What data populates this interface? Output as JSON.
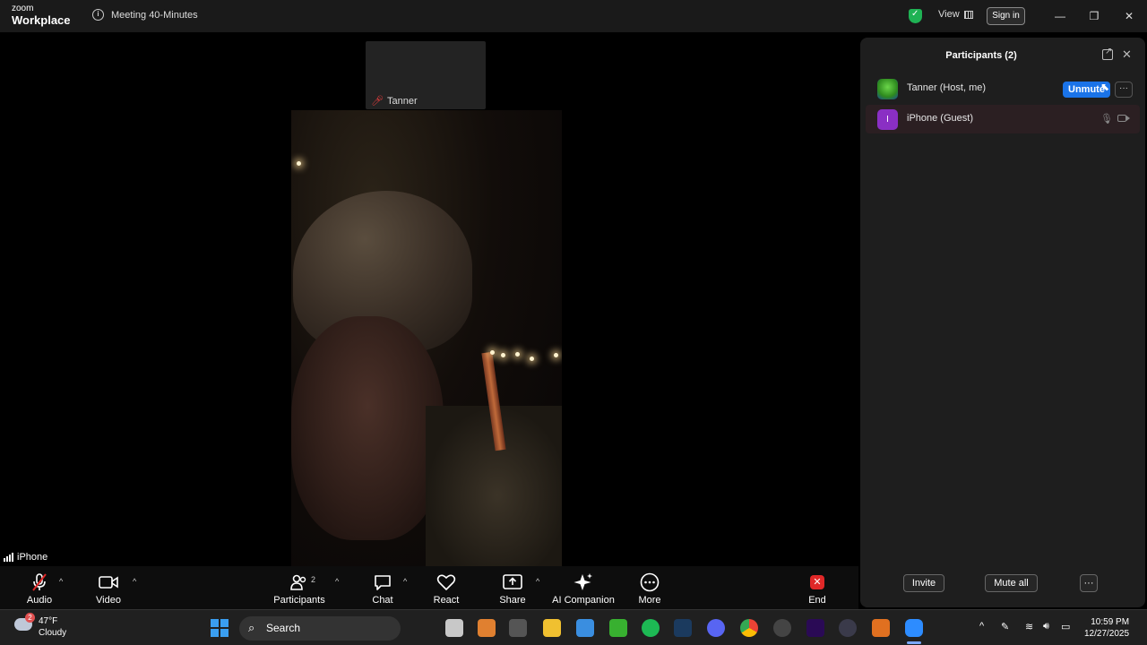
{
  "titlebar": {
    "logo_line1": "zoom",
    "logo_line2": "Workplace",
    "meeting_title": "Meeting 40-Minutes",
    "view_label": "View",
    "signin_label": "Sign in",
    "window_controls": [
      "minimize",
      "restore",
      "close"
    ]
  },
  "stage": {
    "tile_name": "Tanner",
    "active_speaker_name": "iPhone"
  },
  "participants_panel": {
    "title": "Participants (2)",
    "participants": [
      {
        "name": "Tanner (Host, me)",
        "action": "Unmute"
      },
      {
        "name": "iPhone (Guest)",
        "avatar_letter": "I"
      }
    ],
    "invite_label": "Invite",
    "mute_all_label": "Mute all"
  },
  "toolbar": {
    "audio": "Audio",
    "video": "Video",
    "participants": "Participants",
    "participants_count": "2",
    "chat": "Chat",
    "react": "React",
    "share": "Share",
    "ai_companion": "AI Companion",
    "more": "More",
    "end": "End"
  },
  "taskbar": {
    "weather_temp": "47°F",
    "weather_desc": "Cloudy",
    "weather_badge": "2",
    "search_label": "Search",
    "time": "10:59 PM",
    "date": "12/27/2025"
  },
  "colors": {
    "accent_blue": "#1a73e8",
    "end_red": "#e02828",
    "shield_green": "#1fb254"
  }
}
